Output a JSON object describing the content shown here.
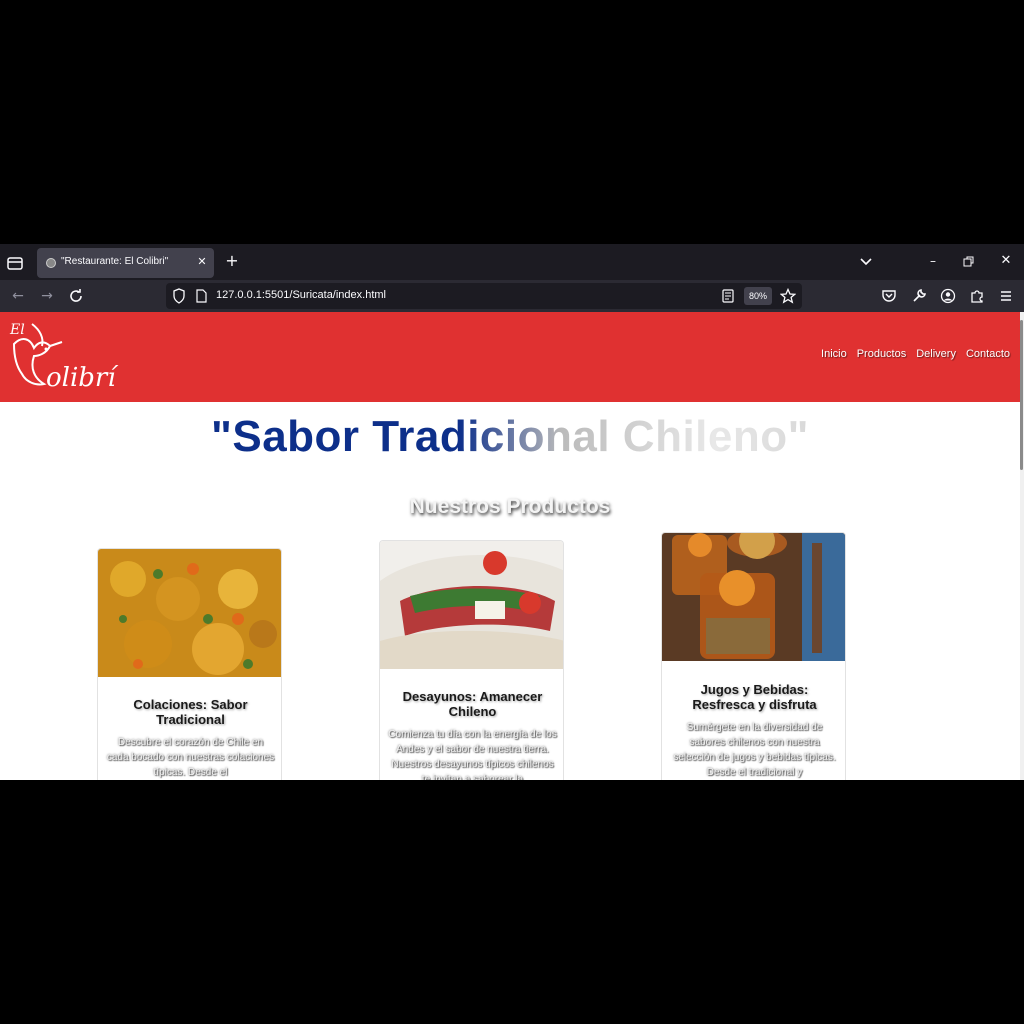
{
  "browser": {
    "tab_title": "\"Restaurante: El Colibri\"",
    "tab_close": "✕",
    "new_tab": "+",
    "url": "127.0.0.1:5501/Suricata/index.html",
    "zoom": "80%",
    "window_min": "–",
    "window_close": "✕",
    "back": "←",
    "forward": "→"
  },
  "site": {
    "logo_text": "El Colibrí",
    "nav": [
      "Inicio",
      "Productos",
      "Delivery",
      "Contacto"
    ],
    "hero_title": "\"Sabor Tradicional Chileno\"",
    "section_title": "Nuestros Productos",
    "colors": {
      "header": "#e03131",
      "title_blue": "#0d2f8a"
    }
  },
  "cards": [
    {
      "title": "Colaciones: Sabor Tradicional",
      "text": "Descubre el corazón de Chile en cada bocado con nuestras colaciones típicas. Desde el"
    },
    {
      "title": "Desayunos: Amanecer Chileno",
      "text": "Comienza tu día con la energía de los Andes y el sabor de nuestra tierra. Nuestros desayunos típicos chilenos te invitan a saborear la"
    },
    {
      "title": "Jugos y Bebidas: Resfresca y disfruta",
      "text": "Sumérgete en la diversidad de sabores chilenos con nuestra selección de jugos y bebidas típicas. Desde el tradicional y"
    }
  ]
}
